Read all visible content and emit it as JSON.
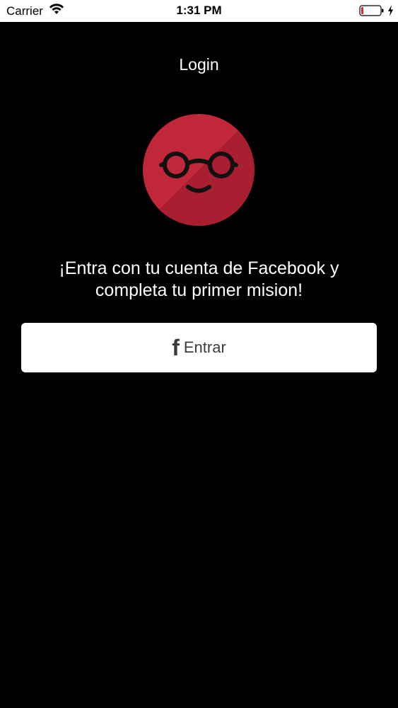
{
  "status_bar": {
    "carrier": "Carrier",
    "time": "1:31 PM",
    "icons": [
      "wifi-icon",
      "battery-icon",
      "bolt-icon"
    ]
  },
  "nav": {
    "title": "Login"
  },
  "avatar": {
    "icon": "glasses-face-icon",
    "color": "#c0283a"
  },
  "main": {
    "message": "¡Entra con tu cuenta de Facebook y completa tu primer mision!",
    "button": {
      "icon": "facebook-icon",
      "label": "Entrar"
    }
  },
  "colors": {
    "background": "#000000",
    "accent": "#c0283a",
    "button_bg": "#ffffff"
  }
}
